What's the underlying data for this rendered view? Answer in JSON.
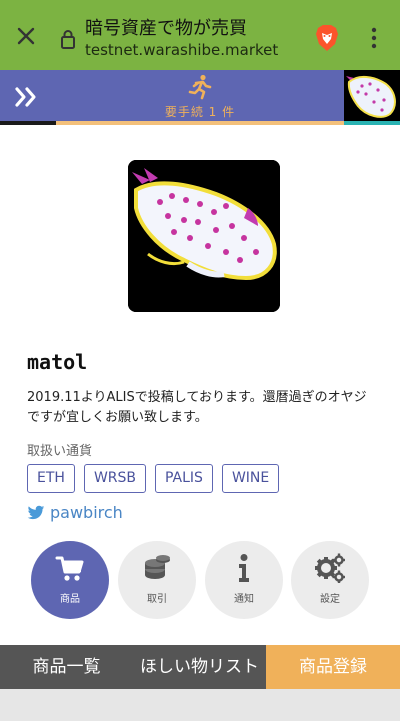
{
  "browser": {
    "tab_title": "暗号資産で物が売買",
    "url": "testnet.warashibe.market",
    "icons": [
      "close-icon",
      "lock-icon",
      "brave-lion-icon",
      "more-vert-icon"
    ]
  },
  "header": {
    "pending_label": "要手続 1 件",
    "icons": [
      "double-chevron-right-icon",
      "running-person-icon"
    ]
  },
  "profile": {
    "username": "matol",
    "bio": "2019.11よりALISで投稿しております。還暦過ぎのオヤジですが宜しくお願い致します。",
    "currency_heading": "取扱い通貨",
    "currencies": [
      "ETH",
      "WRSB",
      "PALIS",
      "WINE"
    ],
    "twitter_handle": "pawbirch"
  },
  "circle_nav": [
    {
      "label": "商品",
      "icon": "cart-icon",
      "active": true
    },
    {
      "label": "取引",
      "icon": "coins-icon",
      "active": false
    },
    {
      "label": "通知",
      "icon": "info-icon",
      "active": false
    },
    {
      "label": "設定",
      "icon": "gears-icon",
      "active": false
    }
  ],
  "bottom_tabs": [
    "商品一覧",
    "ほしい物リスト",
    "商品登録"
  ],
  "colors": {
    "browser_bar": "#7cb342",
    "header": "#5e66b2",
    "accent": "#f0b15a",
    "tab_dark": "#555555",
    "twitter": "#4a86c5"
  }
}
